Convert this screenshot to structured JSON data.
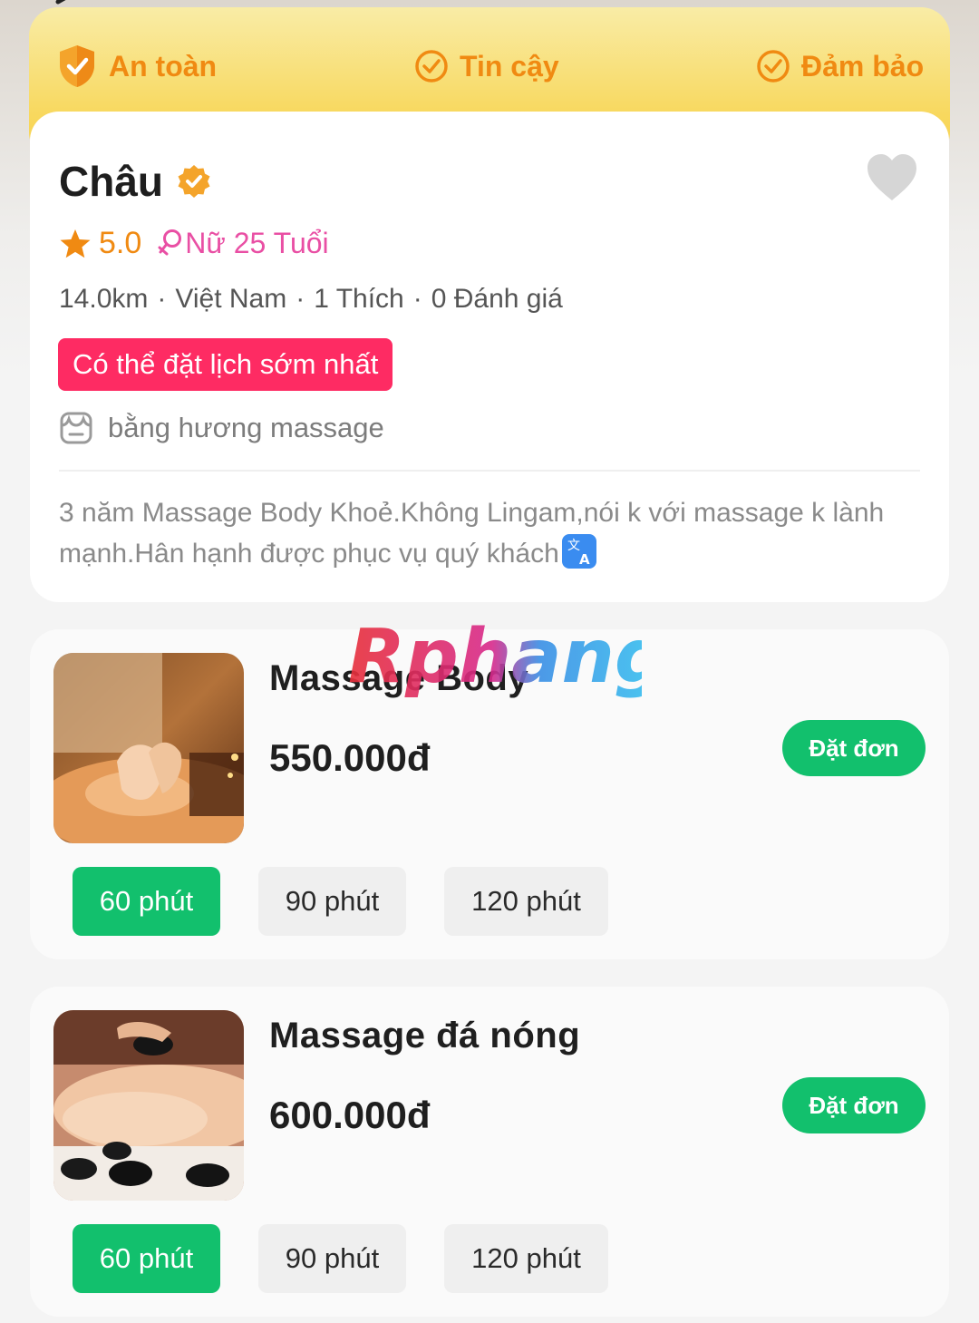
{
  "trust": {
    "item1": "An toàn",
    "item2": "Tin cậy",
    "item3": "Đảm bảo"
  },
  "profile": {
    "name": "Châu",
    "rating": "5.0",
    "gender_age": "Nữ 25 Tuổi",
    "distance": "14.0km",
    "country": "Việt Nam",
    "likes": "1 Thích",
    "reviews": "0 Đánh giá",
    "badge": "Có thể đặt lịch sớm nhất",
    "shop": "bằng hương massage",
    "bio": "3 năm Massage Body Khoẻ.Không Lingam,nói k với massage k lành mạnh.Hân hạnh được phục vụ quý khách"
  },
  "watermark": "Rphang",
  "services": [
    {
      "title": "Massage Body",
      "price": "550.000đ",
      "book_label": "Đặt đơn",
      "durations": [
        "60 phút",
        "90 phút",
        "120 phút"
      ]
    },
    {
      "title": "Massage đá nóng",
      "price": "600.000đ",
      "book_label": "Đặt đơn",
      "durations": [
        "60 phút",
        "90 phút",
        "120 phút"
      ]
    }
  ],
  "colors": {
    "accent_orange": "#f08a12",
    "badge_pink": "#fe2b63",
    "gender_pink": "#e94fa4",
    "book_green": "#12c06d"
  }
}
